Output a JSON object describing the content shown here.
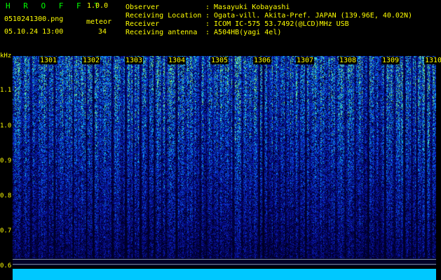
{
  "header": {
    "app_name": "H R O F F T",
    "version": "1.0.0",
    "filename": "0510241300.png",
    "meteor_label": "meteor",
    "datetime": "05.10.24 13:00",
    "meteor_count": "34",
    "info_labels": [
      "Observer",
      "Receiving Location",
      "Receiver",
      "Receiving antenna"
    ],
    "info_values": [
      ": Masayuki Kobayashi",
      ": Ogata-vill. Akita-Pref. JAPAN (139.96E, 40.02N)",
      ": ICOM IC-575 53.7492(@LCD)MHz USB",
      ": A504HB(yagi 4el)"
    ]
  },
  "y_axis": {
    "unit": "kHz",
    "ticks": [
      "1.1",
      "1.0",
      "0.9",
      "0.8",
      "0.7",
      "0.6"
    ],
    "values": [
      1.1,
      1.0,
      0.9,
      0.8,
      0.7,
      0.6
    ]
  },
  "x_axis": {
    "ticks": [
      "1301",
      "1302",
      "1303",
      "1304",
      "1305",
      "1306",
      "1307",
      "1308",
      "1309",
      "1310"
    ]
  },
  "colors": {
    "text": "#ffff00",
    "title": "#00ff00",
    "bottom_strip": "#00c8ff"
  }
}
